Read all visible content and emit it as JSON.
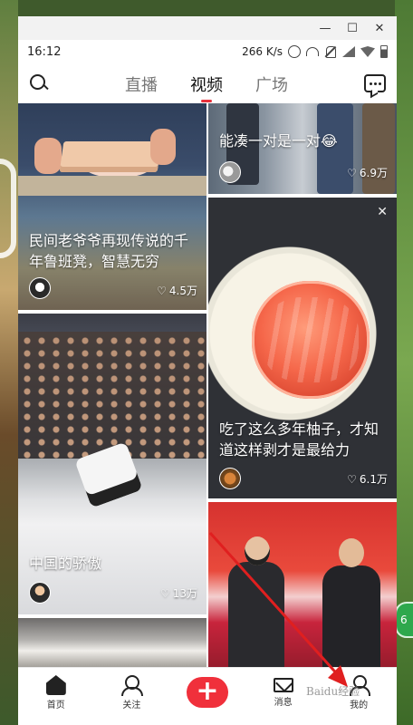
{
  "status_bar": {
    "time": "16:12",
    "speed": "266 K/s"
  },
  "window_controls": {
    "minimize": "—",
    "maximize": "☐",
    "close": "✕"
  },
  "top_nav": {
    "tabs": [
      {
        "label": "直播",
        "active": false
      },
      {
        "label": "视频",
        "active": true
      },
      {
        "label": "广场",
        "active": false
      }
    ],
    "accent_color": "#e8323c"
  },
  "feed": {
    "cards": [
      {
        "caption": "民间老爷爷再现传说的千年鲁班凳，智慧无穷",
        "likes": "4.5万"
      },
      {
        "caption": "能凑一对是一对😂",
        "likes": "6.9万"
      },
      {
        "caption": "吃了这么多年柚子，才知道这样剥才是最给力",
        "likes": "6.1万",
        "close": "✕"
      },
      {
        "caption": "中国的骄傲",
        "likes": "13万"
      }
    ],
    "heart_glyph": "♡"
  },
  "tab_bar": {
    "items": [
      {
        "label": "首页",
        "icon": "home-icon"
      },
      {
        "label": "关注",
        "icon": "follow-icon"
      },
      {
        "label": "+",
        "icon": "plus-icon"
      },
      {
        "label": "消息",
        "icon": "mail-icon"
      },
      {
        "label": "我的",
        "icon": "me-icon"
      }
    ],
    "plus_color": "#f0303b"
  },
  "side_badge": "6",
  "watermark": "Baidu经验"
}
